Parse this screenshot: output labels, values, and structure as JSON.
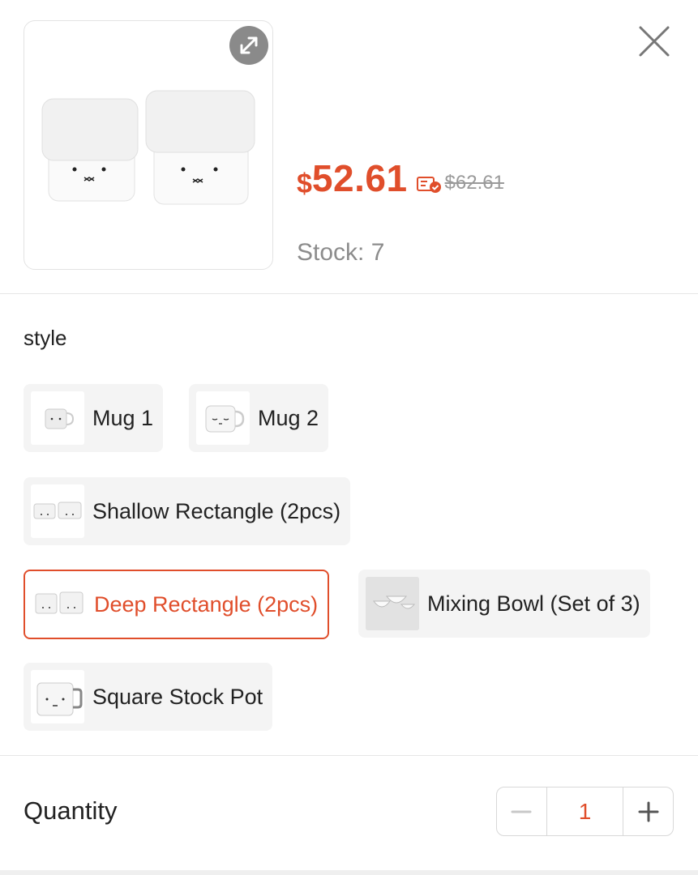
{
  "product": {
    "price_currency": "$",
    "price_value": "52.61",
    "original_price": "$62.61",
    "stock_text": "Stock: 7"
  },
  "colors": {
    "accent": "#e04e2b",
    "muted": "#8c8c8c",
    "chip_bg": "#f4f4f4"
  },
  "icons": {
    "expand": "expand-arrows-icon",
    "close": "close-icon",
    "coupon": "coupon-check-icon",
    "minus": "minus-icon",
    "plus": "plus-icon"
  },
  "style_section": {
    "label": "style",
    "options": [
      {
        "label": "Mug 1",
        "selected": false
      },
      {
        "label": "Mug 2",
        "selected": false
      },
      {
        "label": "Shallow Rectangle (2pcs)",
        "selected": false
      },
      {
        "label": "Deep Rectangle (2pcs)",
        "selected": true
      },
      {
        "label": "Mixing Bowl (Set of 3)",
        "selected": false
      },
      {
        "label": "Square Stock Pot",
        "selected": false
      }
    ]
  },
  "quantity": {
    "label": "Quantity",
    "value": "1"
  }
}
